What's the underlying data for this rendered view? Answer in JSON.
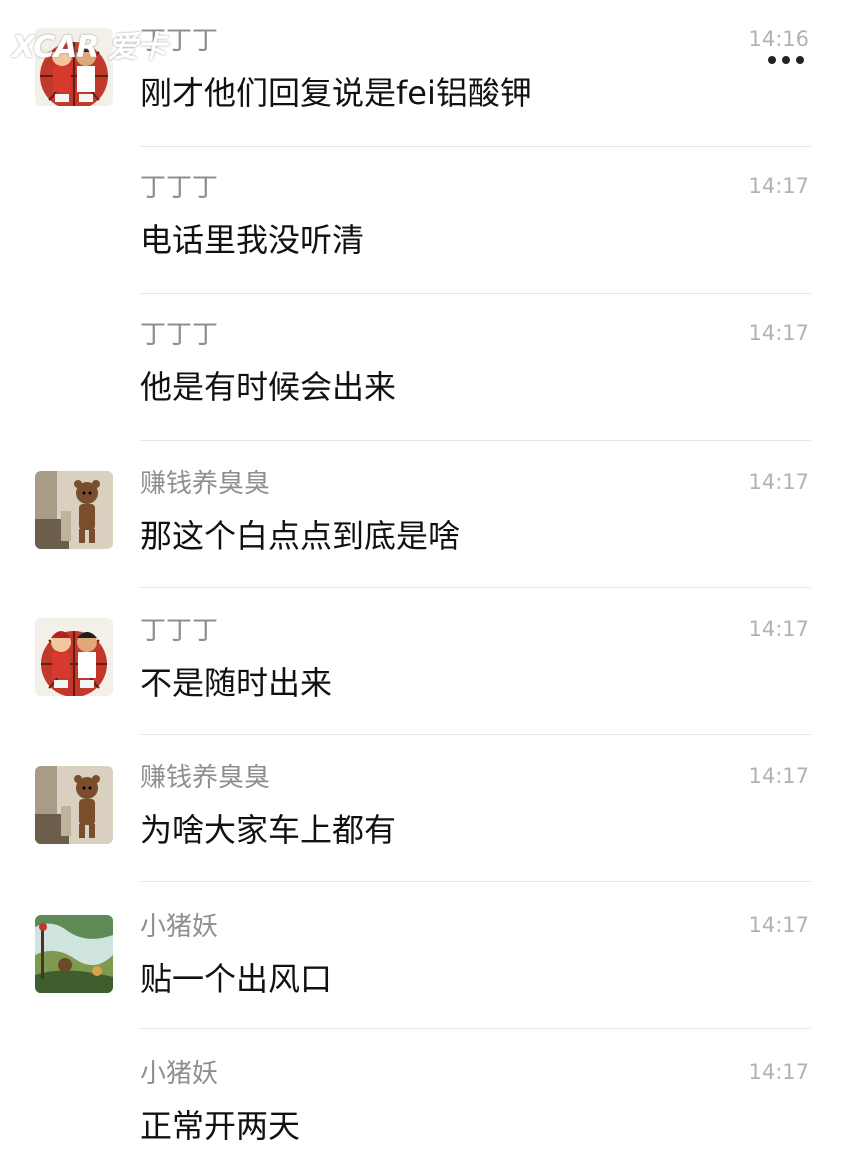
{
  "watermark": "XCAR 爱卡",
  "messages": [
    {
      "sender": "丁丁丁",
      "text": "刚才他们回复说是fei铝酸钾",
      "time": "14:16",
      "avatar": "basketball-avatar"
    },
    {
      "sender": "丁丁丁",
      "text": "电话里我没听清",
      "time": "14:17",
      "avatar": ""
    },
    {
      "sender": "丁丁丁",
      "text": "他是有时候会出来",
      "time": "14:17",
      "avatar": ""
    },
    {
      "sender": "赚钱养臭臭",
      "text": "那这个白点点到底是啥",
      "time": "14:17",
      "avatar": "bear-avatar"
    },
    {
      "sender": "丁丁丁",
      "text": "不是随时出来",
      "time": "14:17",
      "avatar": "basketball-avatar"
    },
    {
      "sender": "赚钱养臭臭",
      "text": "为啥大家车上都有",
      "time": "14:17",
      "avatar": "bear-avatar"
    },
    {
      "sender": "小猪妖",
      "text": "贴一个出风口",
      "time": "14:17",
      "avatar": "landscape-avatar"
    },
    {
      "sender": "小猪妖",
      "text": "正常开两天",
      "time": "14:17",
      "avatar": ""
    }
  ]
}
